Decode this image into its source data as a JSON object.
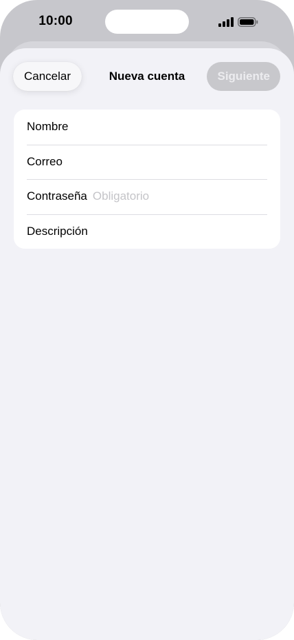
{
  "status_bar": {
    "time": "10:00"
  },
  "icons": {
    "signal": "cellular-signal-icon",
    "battery": "battery-icon"
  },
  "nav": {
    "cancel_label": "Cancelar",
    "title": "Nueva cuenta",
    "next_label": "Siguiente"
  },
  "form": {
    "fields": [
      {
        "label": "Nombre",
        "value": "",
        "placeholder": ""
      },
      {
        "label": "Correo",
        "value": "",
        "placeholder": ""
      },
      {
        "label": "Contraseña",
        "value": "",
        "placeholder": "Obligatorio"
      },
      {
        "label": "Descripción",
        "value": "",
        "placeholder": ""
      }
    ]
  },
  "colors": {
    "sheet_background": "#f2f2f7",
    "card_background": "#ffffff",
    "disabled_button": "#c8c8cc",
    "placeholder_text": "#c4c4c8"
  }
}
